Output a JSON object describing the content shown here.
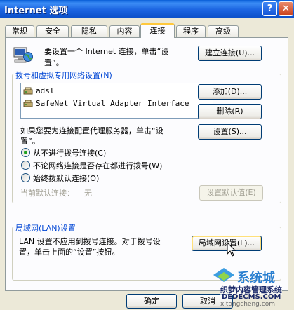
{
  "window": {
    "title": "Internet 选项",
    "help_label": "?",
    "close_label": "✕"
  },
  "tabs": [
    {
      "label": "常规"
    },
    {
      "label": "安全"
    },
    {
      "label": "隐私"
    },
    {
      "label": "内容"
    },
    {
      "label": "连接",
      "active": true
    },
    {
      "label": "程序"
    },
    {
      "label": "高级"
    }
  ],
  "setup": {
    "text_line1": "要设置一个 Internet 连接，单击“设",
    "text_line2": "置”。",
    "button": "建立连接(U)...",
    "icon": "computer-globe-icon"
  },
  "dialup": {
    "group_title": "拨号和虚拟专用网络设置(N)",
    "items": [
      {
        "label": "adsl",
        "icon": "modem-icon"
      },
      {
        "label": "SafeNet Virtual Adapter Interface",
        "icon": "modem-icon"
      }
    ],
    "add_button": "添加(D)...",
    "remove_button": "删除(R)",
    "proxy_text_line1": "如果您要为连接配置代理服务器，单击“设",
    "proxy_text_line2": "置”。",
    "settings_button": "设置(S)...",
    "options": [
      {
        "label": "从不进行拨号连接(C)",
        "checked": true
      },
      {
        "label": "不论网络连接是否存在都进行拨号(W)",
        "checked": false
      },
      {
        "label": "始终拨默认连接(O)",
        "checked": false
      }
    ],
    "current_default_label": "当前默认连接：",
    "current_default_value": "无",
    "set_default_button": "设置默认值(E)"
  },
  "lan": {
    "group_title": "局域网(LAN)设置",
    "text_line1": "LAN 设置不应用到拨号连接。对于拨号设",
    "text_line2": "置，单击上面的“设置”按钮。",
    "button": "局域网设置(L)..."
  },
  "footer": {
    "ok_button": "确定",
    "cancel_button": "取消"
  },
  "watermark": {
    "brand": "系统城",
    "line1": "织梦内容管理系统",
    "line2": "DEDECMS.COM",
    "url": "xitongcheng.com"
  },
  "colors": {
    "group_title": "#0046d5",
    "titlebar": "#0a5fd8",
    "panel": "#fcfcfe",
    "window": "#ece9d8"
  }
}
